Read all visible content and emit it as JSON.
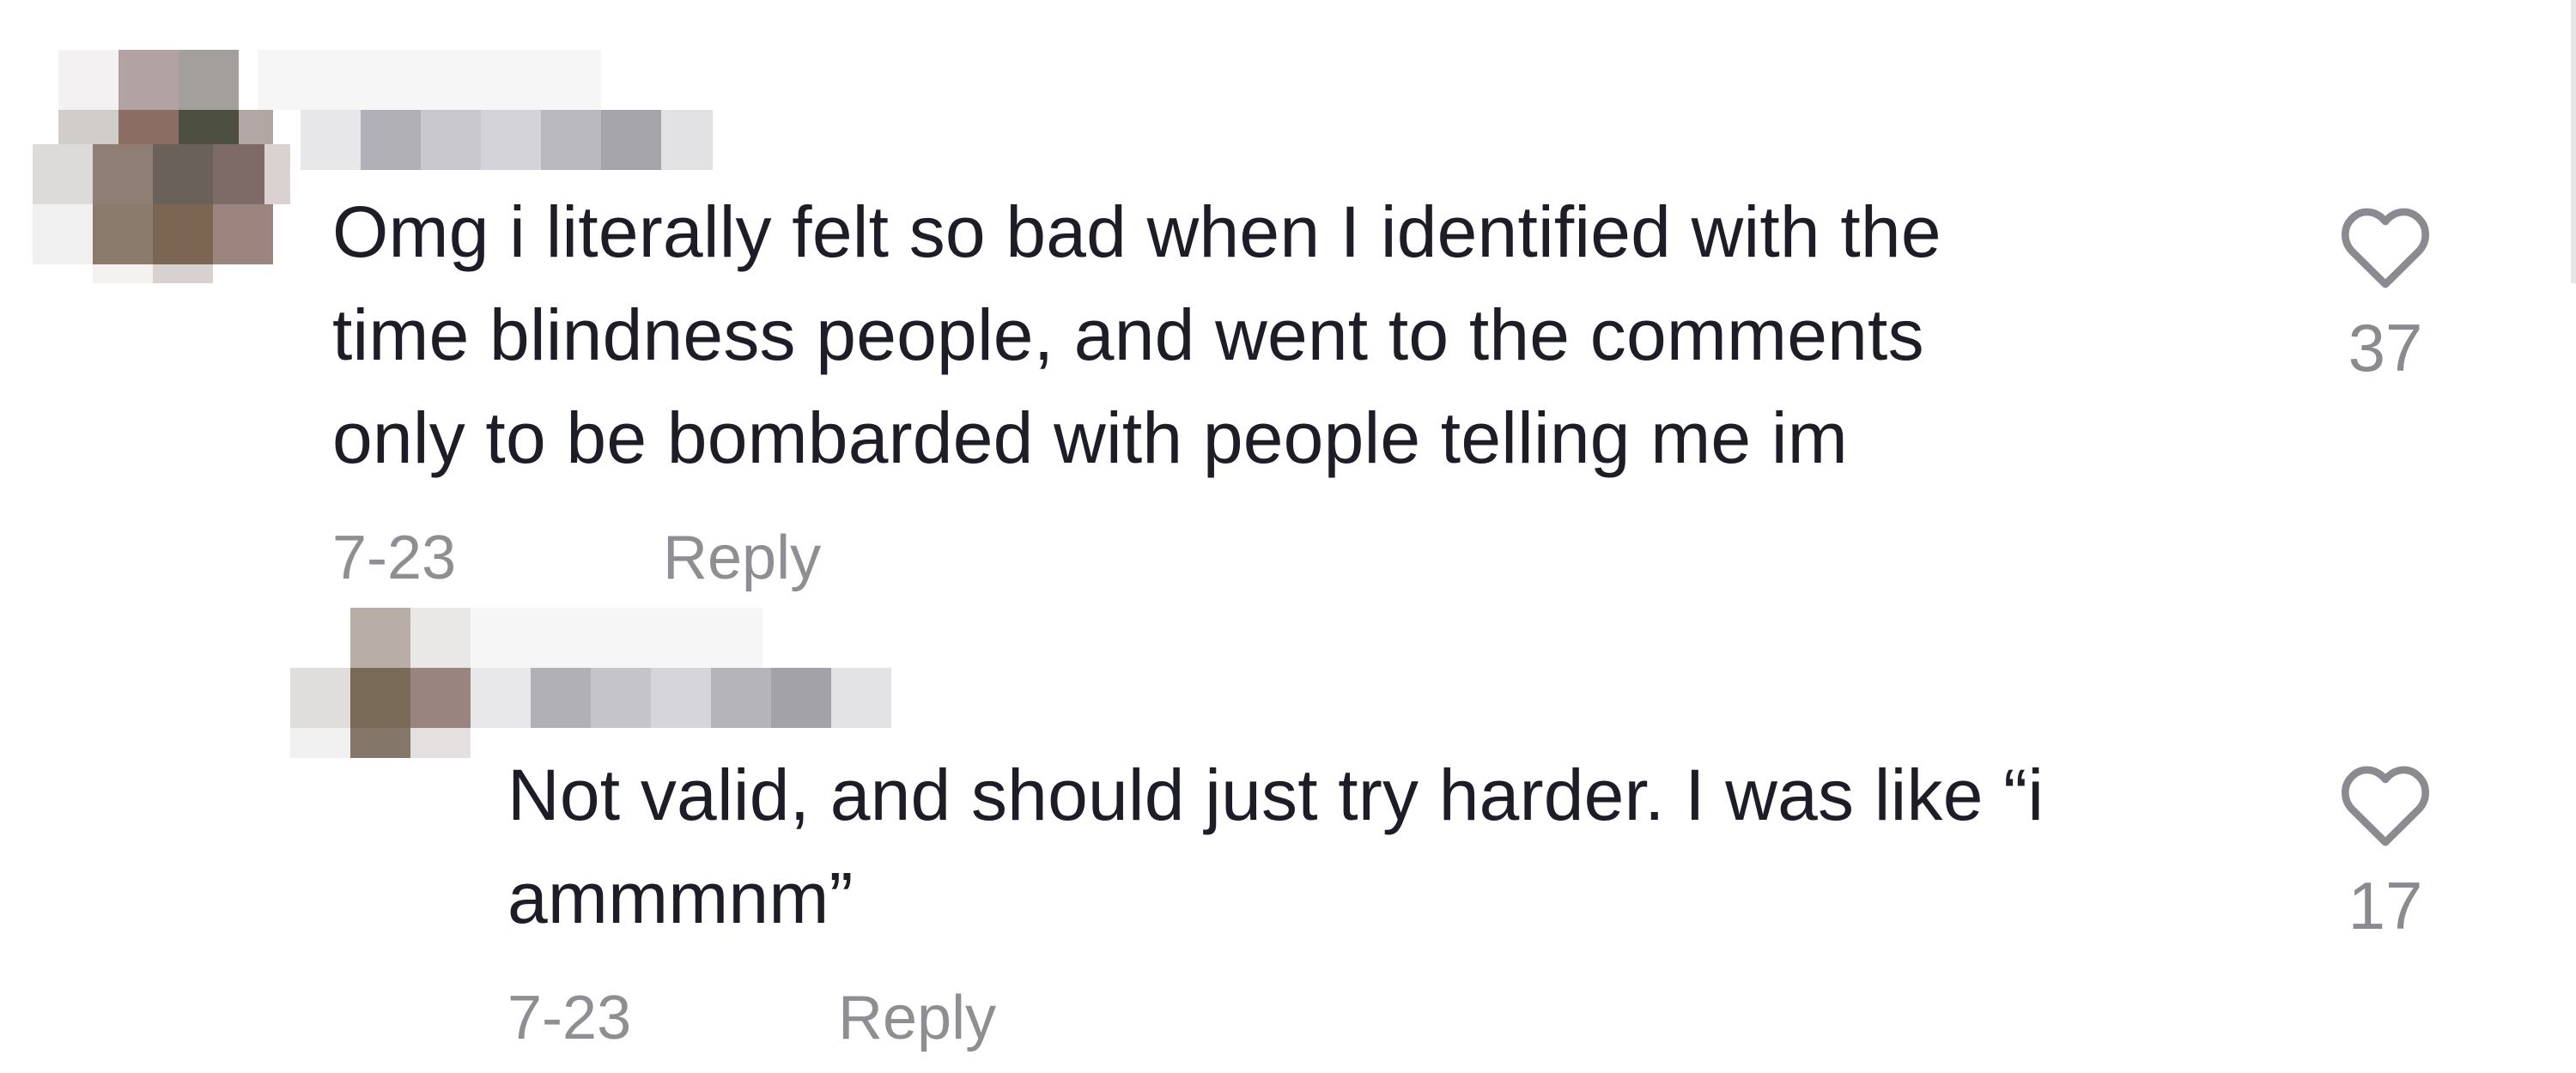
{
  "comments": [
    {
      "text_lines": [
        "Omg i literally felt so bad when I identified with the",
        "time blindness people, and went to the comments",
        "only to be bombarded with people telling me im"
      ],
      "date": "7-23",
      "reply_label": "Reply",
      "like_count": "37",
      "like_icon": "heart-outline-icon"
    },
    {
      "text_lines": [
        "Not valid, and should just try harder. I was like “i",
        "ammmnm”"
      ],
      "date": "7-23",
      "reply_label": "Reply",
      "like_count": "17",
      "like_icon": "heart-outline-icon"
    }
  ],
  "colors": {
    "text": "#1d1d27",
    "meta": "#8e8e93",
    "icon": "#8a8a90"
  }
}
